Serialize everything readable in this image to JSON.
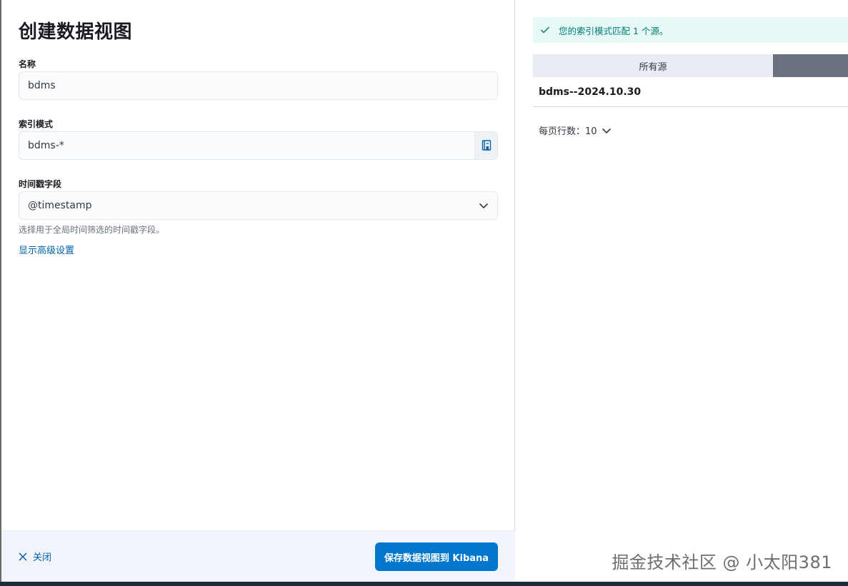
{
  "form": {
    "title": "创建数据视图",
    "name_label": "名称",
    "name_value": "bdms",
    "index_label": "索引模式",
    "index_value": "bdms-*",
    "timestamp_label": "时间戳字段",
    "timestamp_value": "@timestamp",
    "timestamp_help": "选择用于全局时间筛选的时间戳字段。",
    "advanced_link": "显示高级设置"
  },
  "footer": {
    "close_label": "关闭",
    "save_label": "保存数据视图到 Kibana"
  },
  "preview": {
    "callout": "您的索引模式匹配 1 个源。",
    "tab_all": "所有源",
    "sources": [
      "bdms--2024.10.30"
    ],
    "rows_per_page_label": "每页行数：10"
  },
  "watermark": "掘金技术社区 @ 小太阳381",
  "icons": {
    "append": "book-icon",
    "select": "chevron-down-icon",
    "close": "close-icon",
    "callout": "check-icon"
  },
  "colors": {
    "primary": "#0077cc",
    "link": "#0061a6",
    "success_bg": "#e6f9f7",
    "success_text": "#017d73"
  }
}
